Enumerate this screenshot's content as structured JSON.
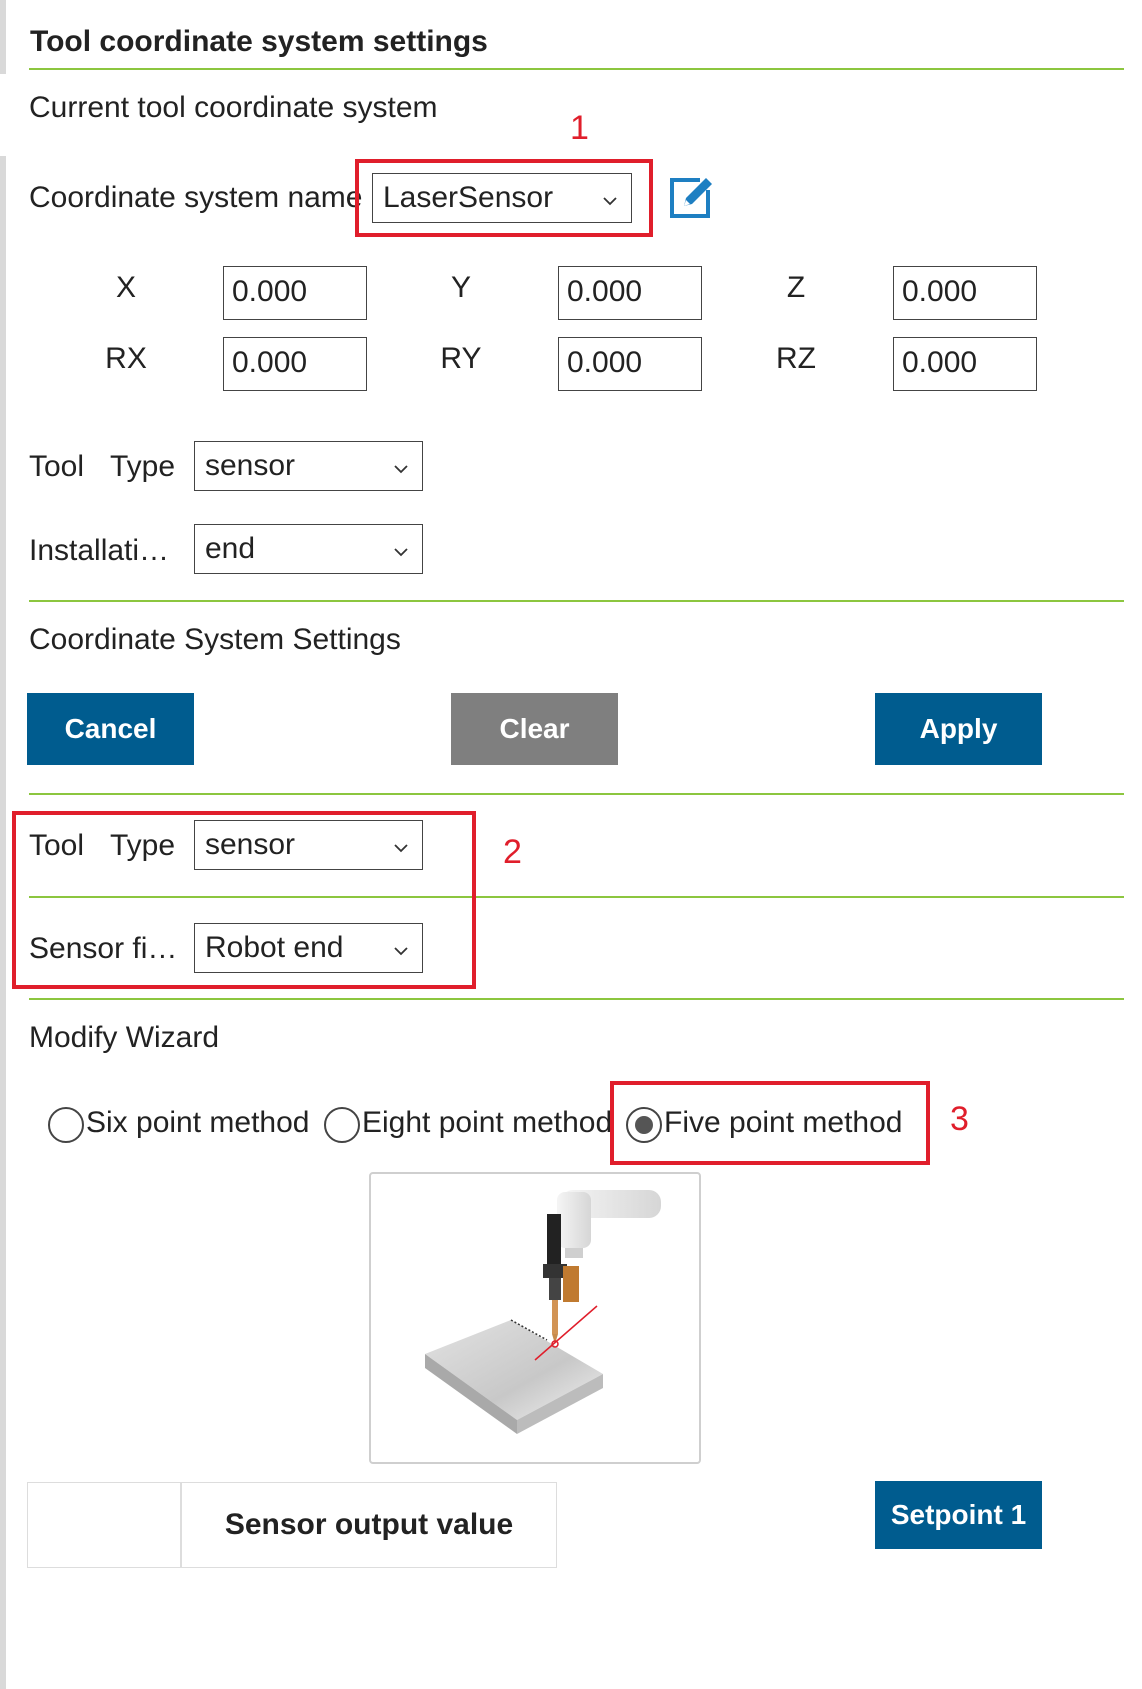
{
  "title": "Tool coordinate system settings",
  "current_section": {
    "heading": "Current tool coordinate system",
    "coord_name_label": "Coordinate system name",
    "coord_name_value": "LaserSensor",
    "axes": [
      {
        "label": "X",
        "value": "0.000"
      },
      {
        "label": "Y",
        "value": "0.000"
      },
      {
        "label": "Z",
        "value": "0.000"
      },
      {
        "label": "RX",
        "value": "0.000"
      },
      {
        "label": "RY",
        "value": "0.000"
      },
      {
        "label": "RZ",
        "value": "0.000"
      }
    ],
    "tool_type_label_a": "Tool",
    "tool_type_label_b": "Type",
    "tool_type_value": "sensor",
    "installation_label": "Installati…",
    "installation_value": "end"
  },
  "settings_section": {
    "heading": "Coordinate System Settings",
    "cancel_label": "Cancel",
    "clear_label": "Clear",
    "apply_label": "Apply",
    "tool_type_label_a": "Tool",
    "tool_type_label_b": "Type",
    "tool_type_value": "sensor",
    "sensor_fix_label": "Sensor fi…",
    "sensor_fix_value": "Robot end"
  },
  "wizard": {
    "heading": "Modify Wizard",
    "methods": [
      {
        "label": "Six point method",
        "selected": false
      },
      {
        "label": "Eight point method",
        "selected": false
      },
      {
        "label": "Five point method",
        "selected": true
      }
    ],
    "image_icon": "robot-laser-sensor-illustration"
  },
  "footer": {
    "sensor_output_label": "Sensor output value",
    "setpoint_label": "Setpoint 1"
  },
  "annotations": {
    "one": "1",
    "two": "2",
    "three": "3"
  },
  "colors": {
    "accent_line": "#8cc63f",
    "primary_button": "#005c8f",
    "secondary_button": "#7f7f7f",
    "annotation_red": "#e01e2b",
    "edit_icon": "#1e7fc2"
  }
}
